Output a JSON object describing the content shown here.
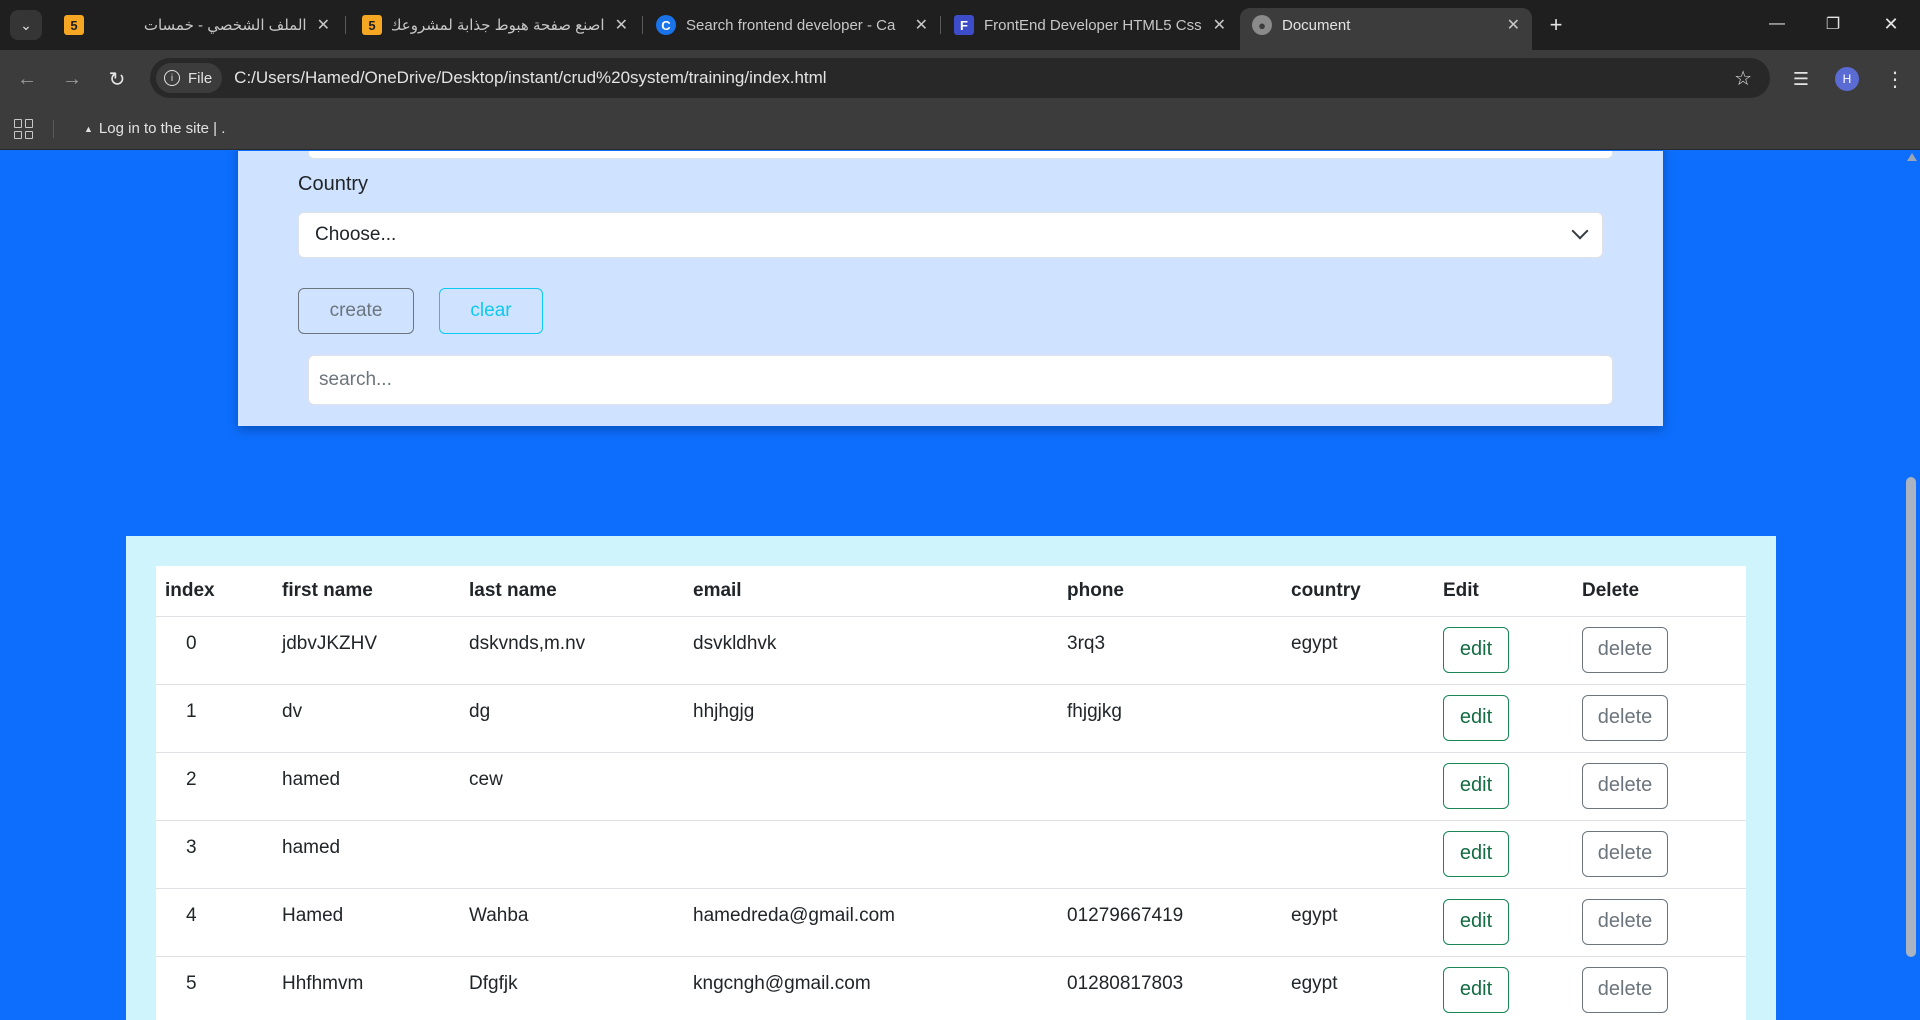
{
  "browser": {
    "tabs": [
      {
        "title": "الملف الشخصي - خمسات",
        "favicon": "5"
      },
      {
        "title": "اصنع صفحة هبوط جذابة لمشروعك",
        "favicon": "5"
      },
      {
        "title": "Search frontend developer - Ca",
        "favicon": "C"
      },
      {
        "title": "FrontEnd Developer HTML5 Css",
        "favicon": "F"
      },
      {
        "title": "Document",
        "favicon": ""
      }
    ],
    "file_chip": "File",
    "url": "C:/Users/Hamed/OneDrive/Desktop/instant/crud%20system/training/index.html",
    "avatar_letter": "H",
    "bookmark": "Log in to the site | ."
  },
  "form": {
    "country_label": "Country",
    "country_selected": "Choose...",
    "create_label": "create",
    "clear_label": "clear",
    "search_placeholder": "search..."
  },
  "table": {
    "headers": [
      "index",
      "first name",
      "last name",
      "email",
      "phone",
      "country",
      "Edit",
      "Delete"
    ],
    "edit_label": "edit",
    "delete_label": "delete",
    "rows": [
      {
        "index": "0",
        "first": "jdbvJKZHV",
        "last": "dskvnds,m.nv",
        "email": "dsvkldhvk",
        "phone": "3rq3",
        "country": "egypt"
      },
      {
        "index": "1",
        "first": "dv",
        "last": "dg",
        "email": "hhjhgjg",
        "phone": "fhjgjkg",
        "country": ""
      },
      {
        "index": "2",
        "first": "hamed",
        "last": "cew",
        "email": "",
        "phone": "",
        "country": ""
      },
      {
        "index": "3",
        "first": "hamed",
        "last": "",
        "email": "",
        "phone": "",
        "country": ""
      },
      {
        "index": "4",
        "first": "Hamed",
        "last": "Wahba",
        "email": "hamedreda@gmail.com",
        "phone": "01279667419",
        "country": "egypt"
      },
      {
        "index": "5",
        "first": "Hhfhmvm",
        "last": "Dfgfjk",
        "email": "kngcngh@gmail.com",
        "phone": "01280817803",
        "country": "egypt"
      }
    ]
  },
  "colors": {
    "page_bg": "#0d6efd",
    "form_bg": "#cfe2ff",
    "table_bg": "#cff4fc",
    "edit_border": "#198754",
    "clear_color": "#0dcaf0"
  }
}
